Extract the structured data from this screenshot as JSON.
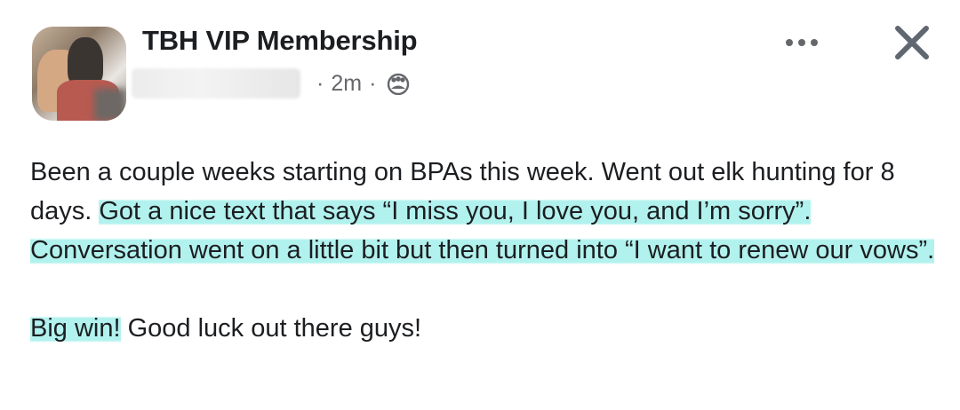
{
  "post": {
    "group_name": "TBH VIP Membership",
    "time": "2m",
    "separator": "·",
    "icons": {
      "audience": "friends-icon",
      "more": "more-options-icon",
      "close": "close-icon"
    },
    "highlight_color": "#98eee8",
    "paragraph1": {
      "plain1": "Been a couple weeks starting on BPAs this week. Went out elk hunting for 8 days. ",
      "highlight1": "Got a nice text that says “I miss you, I love you, and I’m sorry”. Conversation went on a little bit but then turned into “I want to renew our vows”."
    },
    "paragraph2": {
      "highlight": "Big win!",
      "plain": " Good luck out there guys!"
    }
  }
}
